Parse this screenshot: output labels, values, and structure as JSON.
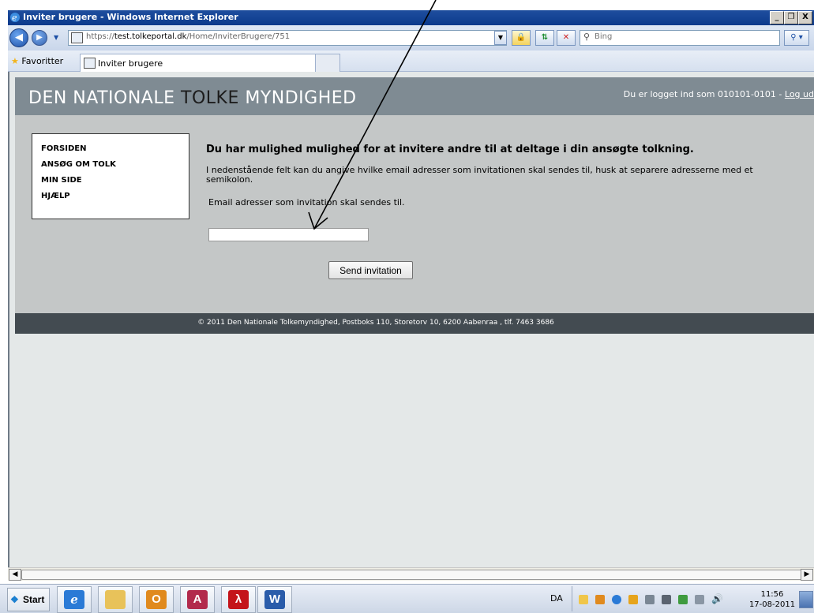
{
  "window": {
    "title": "Inviter brugere - Windows Internet Explorer",
    "controls": [
      "_",
      "❐",
      "X"
    ]
  },
  "address_bar": {
    "url_scheme": "https://",
    "url_host": "test.tolkeportal.dk",
    "url_path": "/Home/InviterBrugere/751",
    "search_placeholder": "Bing",
    "back_icon": "back-arrow-icon",
    "forward_icon": "forward-arrow-icon"
  },
  "favorites_bar": {
    "favorites_label": "Favoritter",
    "tab_label": "Inviter brugere"
  },
  "site": {
    "logo_light_1": "DEN NATIONALE ",
    "logo_dark": "TOLKE",
    "logo_light_2": " MYNDIGHED",
    "login_text": "Du er logget ind som 010101-0101 - ",
    "logout_label": "Log ud",
    "nav": [
      "FORSIDEN",
      "ANSØG OM TOLK",
      "MIN SIDE",
      "HJÆLP"
    ],
    "heading": "Du har mulighed mulighed for at invitere andre til at deltage i din ansøgte tolkning.",
    "description": "I nedenstående felt kan du angive hvilke email adresser som invitationen skal sendes til, husk at separere adresserne med et semikolon.",
    "email_label": "Email adresser som invitation skal sendes til.",
    "email_value": "",
    "send_button": "Send invitation",
    "footer": "© 2011 Den Nationale Tolkemyndighed, Postboks 110, Storetorv 10, 6200 Aabenraa , tlf. 7463 3686"
  },
  "taskbar": {
    "start_label": "Start",
    "apps": [
      "internet-explorer",
      "windows-explorer",
      "outlook",
      "access",
      "acrobat-reader",
      "word"
    ],
    "language": "DA",
    "time": "11:56",
    "date": "17-08-2011"
  },
  "colors": {
    "header_bg": "#7f8b93",
    "body_bg": "#c4c7c7",
    "footer_bg": "#434b51",
    "titlebar": "#1f4e9e"
  }
}
